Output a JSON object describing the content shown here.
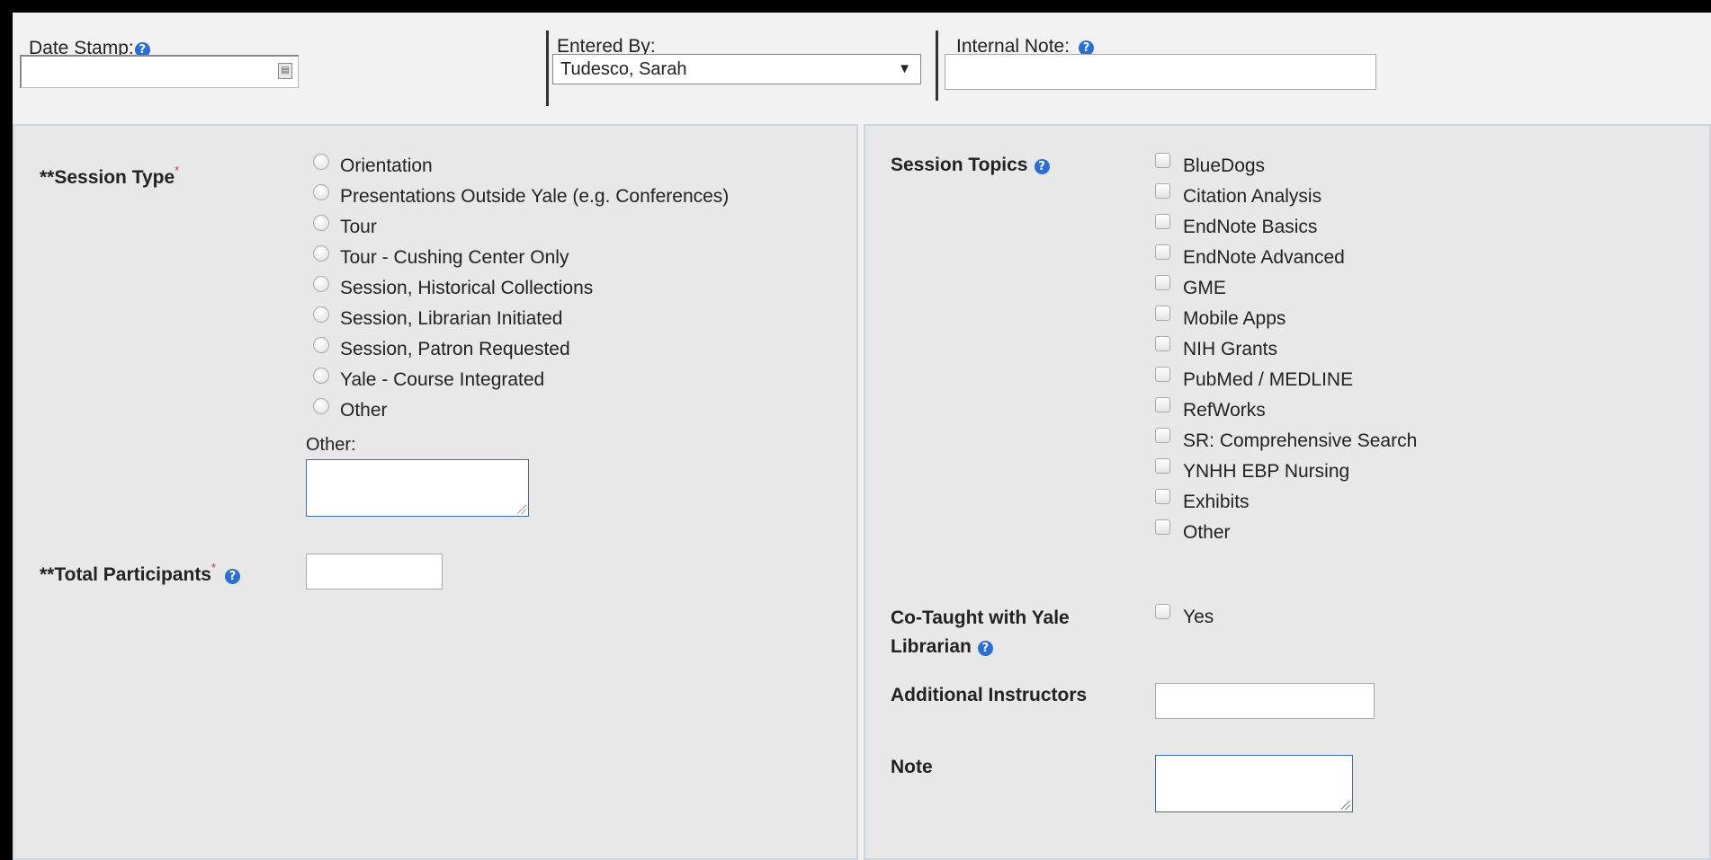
{
  "header": {
    "date_stamp_label": "Date Stamp:",
    "date_stamp_value": "",
    "entered_by_label": "Entered By:",
    "entered_by_value": "Tudesco, Sarah",
    "internal_note_label": "Internal Note:",
    "internal_note_value": ""
  },
  "help_glyph": "?",
  "required_marker": "*",
  "session_type": {
    "label": "**Session Type",
    "options": [
      "Orientation",
      "Presentations Outside Yale (e.g. Conferences)",
      "Tour",
      "Tour - Cushing Center Only",
      "Session, Historical Collections",
      "Session, Librarian Initiated",
      "Session, Patron Requested",
      "Yale - Course Integrated",
      "Other"
    ],
    "other_label": "Other:",
    "other_value": ""
  },
  "total_participants": {
    "label": "**Total Participants",
    "value": ""
  },
  "session_topics": {
    "label": "Session Topics",
    "options": [
      "BlueDogs",
      "Citation Analysis",
      "EndNote Basics",
      "EndNote Advanced",
      "GME",
      "Mobile Apps",
      "NIH Grants",
      "PubMed / MEDLINE",
      "RefWorks",
      "SR: Comprehensive Search",
      "YNHH EBP Nursing",
      "Exhibits",
      "Other"
    ]
  },
  "co_taught": {
    "label_line1": "Co-Taught with Yale",
    "label_line2": "Librarian",
    "option": "Yes"
  },
  "additional_instructors": {
    "label": "Additional Instructors",
    "value": ""
  },
  "note": {
    "label": "Note",
    "value": ""
  },
  "icons": {
    "help": "help-circle-icon",
    "calendar": "calendar-icon",
    "dropdown": "dropdown-arrow-icon"
  },
  "colors": {
    "help_icon": "#2a6fd6",
    "required": "#d9342b",
    "panel_bg": "#e8e8e8",
    "panel_border": "#c9d7e3"
  }
}
